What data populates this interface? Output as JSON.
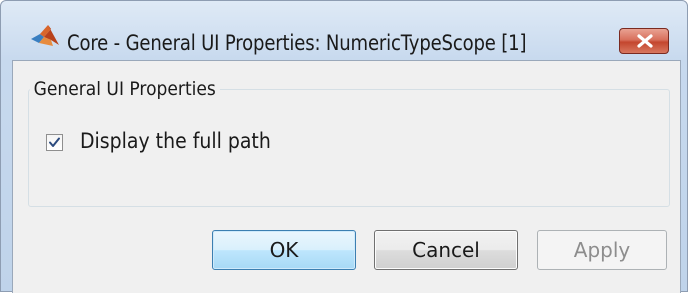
{
  "window": {
    "title": "Core - General UI Properties: NumericTypeScope [1]",
    "app_icon": "matlab-logo-icon",
    "close_icon": "close-icon"
  },
  "group": {
    "title": "General UI Properties"
  },
  "checkbox": {
    "label": "Display the full path",
    "checked": true
  },
  "buttons": {
    "ok_label": "OK",
    "cancel_label": "Cancel",
    "apply_label": "Apply",
    "apply_enabled": false
  },
  "colors": {
    "close_button": "#c4462e",
    "default_button_border": "#3c7fb1",
    "disabled_text": "#8d8d8d"
  }
}
